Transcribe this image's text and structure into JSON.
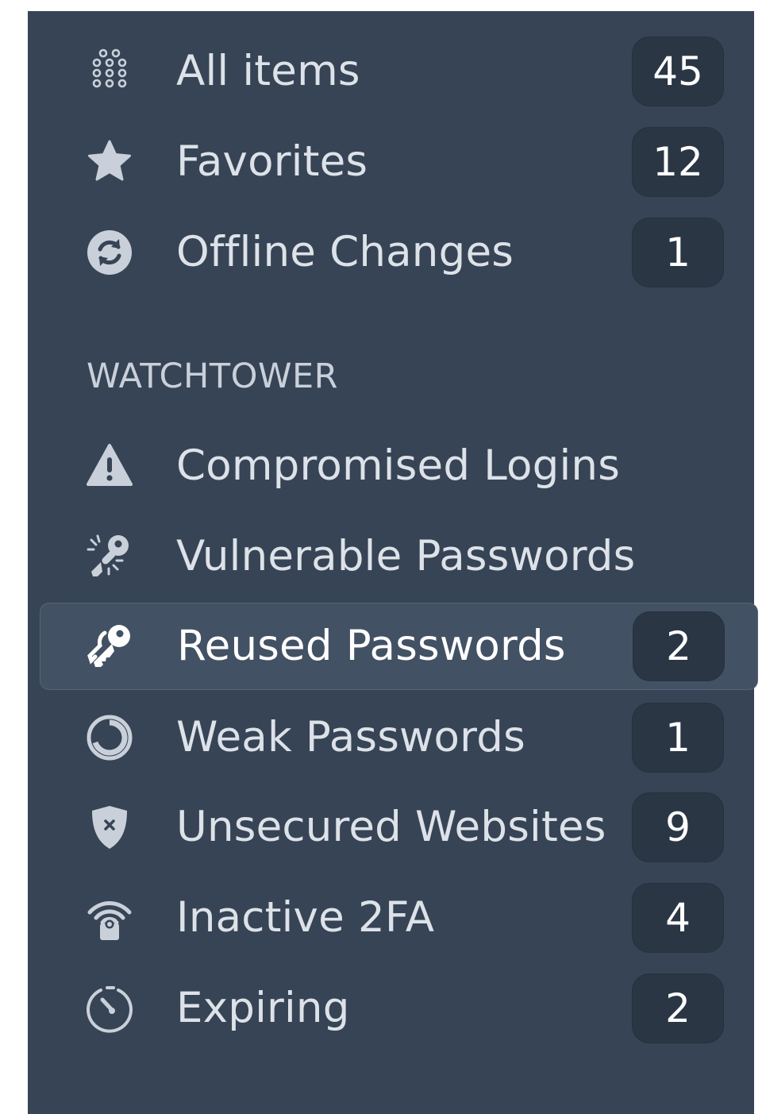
{
  "sidebar": {
    "items": [
      {
        "label": "All items",
        "count": "45",
        "icon": "grid-dots-icon"
      },
      {
        "label": "Favorites",
        "count": "12",
        "icon": "star-icon"
      },
      {
        "label": "Offline Changes",
        "count": "1",
        "icon": "sync-icon"
      }
    ],
    "watchtower": {
      "header": "WATCHTOWER",
      "items": [
        {
          "label": "Compromised Logins",
          "count": null,
          "icon": "warning-icon"
        },
        {
          "label": "Vulnerable Passwords",
          "count": null,
          "icon": "broken-key-icon"
        },
        {
          "label": "Reused Passwords",
          "count": "2",
          "icon": "keys-icon",
          "selected": true
        },
        {
          "label": "Weak Passwords",
          "count": "1",
          "icon": "ring-icon"
        },
        {
          "label": "Unsecured Websites",
          "count": "9",
          "icon": "shield-x-icon"
        },
        {
          "label": "Inactive 2FA",
          "count": "4",
          "icon": "lock-signal-icon"
        },
        {
          "label": "Expiring",
          "count": "2",
          "icon": "timer-icon"
        }
      ]
    }
  },
  "colors": {
    "sidebar_bg": "#374455",
    "selected_bg": "#435164",
    "badge_bg": "#2b3645",
    "text": "#dde2e9"
  }
}
